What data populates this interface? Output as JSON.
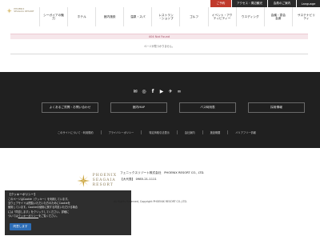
{
  "header": {
    "logo_text": "PHOENIX SEAGAIA RESORT",
    "topbar": {
      "yoyaku": "ご予約",
      "access": "アクセス・周辺観光",
      "member": "会員のご案内",
      "language": "Language"
    },
    "nav": [
      "シーガイアの魅\n力",
      "ホテル",
      "館内施設",
      "温泉・スパ",
      "レストラン\n・ショップ",
      "ゴルフ",
      "イベント・アク\nティビティー",
      "ウエディング",
      "会議・宴会\n会席",
      "サステナビリ\nティ"
    ]
  },
  "main": {
    "notfound_title": "404 Not Found",
    "notfound_message": "ページが見つかりません。"
  },
  "footer": {
    "social_icons": [
      "mail-icon",
      "instagram-icon",
      "facebook-icon",
      "youtube-icon",
      "twitter-icon",
      "tripadvisor-icon"
    ],
    "buttons": [
      "よくあるご質問・お問い合わせ",
      "館内MAP",
      "バス時刻表",
      "採用情報"
    ],
    "links": [
      "このサイトについて・利用規約",
      "プライバシーポリシー",
      "特定商取引法表示",
      "会社案内",
      "施設概要",
      "バリアフリー情報"
    ]
  },
  "bottom": {
    "logo_text": [
      "PHOENIX",
      "SEAGAIA",
      "RESORT"
    ],
    "company": "フェニックスリゾート株式会社　PHOENIX RESORT CO., LTD.",
    "phone": "【大代表】 0985-21-1111",
    "copyright": "All Rights Reserved, Copyright PHOENIX RESORT CO.,LTD."
  },
  "cookie": {
    "title": "【クッキーポリシー】",
    "line1": "このページはCookie（クッキー）を利用しています。",
    "line2": "当ウェブサイトは閲覧いただいた方のためにCookieを",
    "line3": "使用しています。Cookieの使用に関する同意いただける場合",
    "line4": "には「同意します」をクリックしてください。詳細に",
    "line5_pre": "ついては",
    "line5_link": "クッキーポリシー",
    "line5_post": "をご覧ください。",
    "button": "同意します"
  }
}
